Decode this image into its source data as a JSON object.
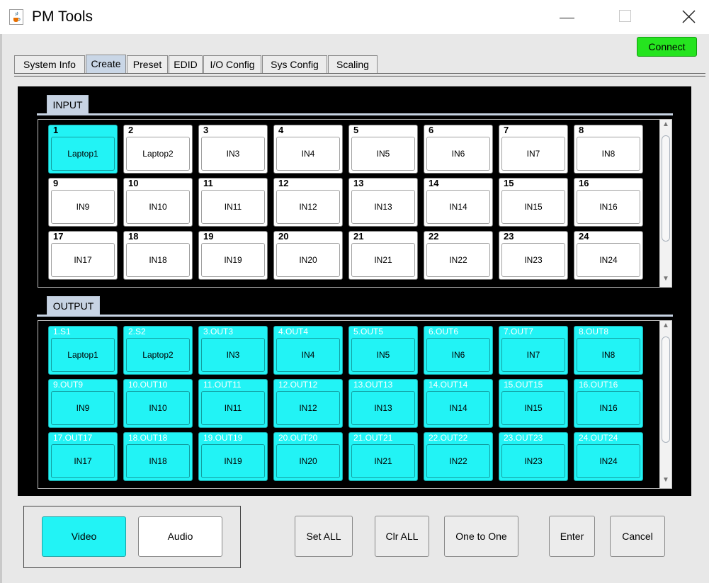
{
  "window": {
    "title": "PM Tools",
    "app_icon": "java-cup-icon"
  },
  "window_controls": {
    "minimize": "minimize-icon",
    "maximize": "maximize-icon",
    "close": "close-icon"
  },
  "connect_label": "Connect",
  "colors": {
    "connect": "#25e41f",
    "selected": "#22f3f5",
    "panel_bg": "#000000",
    "active_tab": "#c9d6e6"
  },
  "tabs": [
    {
      "label": "System Info"
    },
    {
      "label": "Create",
      "active": true
    },
    {
      "label": "Preset"
    },
    {
      "label": "EDID"
    },
    {
      "label": "I/O Config"
    },
    {
      "label": "Sys Config"
    },
    {
      "label": "Scaling"
    }
  ],
  "input_section": {
    "title": "INPUT",
    "cells": [
      {
        "num": "1",
        "label": "Laptop1",
        "selected": true
      },
      {
        "num": "2",
        "label": "Laptop2"
      },
      {
        "num": "3",
        "label": "IN3"
      },
      {
        "num": "4",
        "label": "IN4"
      },
      {
        "num": "5",
        "label": "IN5"
      },
      {
        "num": "6",
        "label": "IN6"
      },
      {
        "num": "7",
        "label": "IN7"
      },
      {
        "num": "8",
        "label": "IN8"
      },
      {
        "num": "9",
        "label": "IN9"
      },
      {
        "num": "10",
        "label": "IN10"
      },
      {
        "num": "11",
        "label": "IN11"
      },
      {
        "num": "12",
        "label": "IN12"
      },
      {
        "num": "13",
        "label": "IN13"
      },
      {
        "num": "14",
        "label": "IN14"
      },
      {
        "num": "15",
        "label": "IN15"
      },
      {
        "num": "16",
        "label": "IN16"
      },
      {
        "num": "17",
        "label": "IN17"
      },
      {
        "num": "18",
        "label": "IN18"
      },
      {
        "num": "19",
        "label": "IN19"
      },
      {
        "num": "20",
        "label": "IN20"
      },
      {
        "num": "21",
        "label": "IN21"
      },
      {
        "num": "22",
        "label": "IN22"
      },
      {
        "num": "23",
        "label": "IN23"
      },
      {
        "num": "24",
        "label": "IN24"
      }
    ]
  },
  "output_section": {
    "title": "OUTPUT",
    "cells": [
      {
        "num": "1.S1",
        "label": "Laptop1"
      },
      {
        "num": "2.S2",
        "label": "Laptop2"
      },
      {
        "num": "3.OUT3",
        "label": "IN3"
      },
      {
        "num": "4.OUT4",
        "label": "IN4"
      },
      {
        "num": "5.OUT5",
        "label": "IN5"
      },
      {
        "num": "6.OUT6",
        "label": "IN6"
      },
      {
        "num": "7.OUT7",
        "label": "IN7"
      },
      {
        "num": "8.OUT8",
        "label": "IN8"
      },
      {
        "num": "9.OUT9",
        "label": "IN9"
      },
      {
        "num": "10.OUT10",
        "label": "IN10"
      },
      {
        "num": "11.OUT11",
        "label": "IN11"
      },
      {
        "num": "12.OUT12",
        "label": "IN12"
      },
      {
        "num": "13.OUT13",
        "label": "IN13"
      },
      {
        "num": "14.OUT14",
        "label": "IN14"
      },
      {
        "num": "15.OUT15",
        "label": "IN15"
      },
      {
        "num": "16.OUT16",
        "label": "IN16"
      },
      {
        "num": "17.OUT17",
        "label": "IN17"
      },
      {
        "num": "18.OUT18",
        "label": "IN18"
      },
      {
        "num": "19.OUT19",
        "label": "IN19"
      },
      {
        "num": "20.OUT20",
        "label": "IN20"
      },
      {
        "num": "21.OUT21",
        "label": "IN21"
      },
      {
        "num": "22.OUT22",
        "label": "IN22"
      },
      {
        "num": "23.OUT23",
        "label": "IN23"
      },
      {
        "num": "24.OUT24",
        "label": "IN24"
      }
    ]
  },
  "mode_buttons": {
    "video": "Video",
    "audio": "Audio"
  },
  "action_buttons": {
    "set_all": "Set ALL",
    "clr_all": "Clr ALL",
    "one_to_one": "One to One",
    "enter": "Enter",
    "cancel": "Cancel"
  }
}
